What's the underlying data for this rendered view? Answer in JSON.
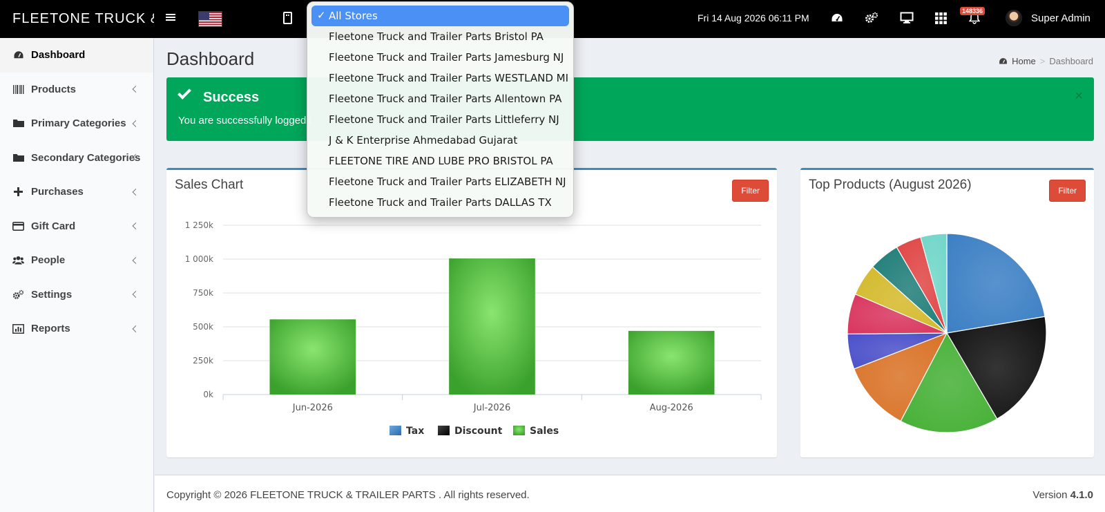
{
  "app": {
    "logo_text": "FLEETONE  TRUCK &",
    "datetime": "Fri 14 Aug 2026 06:11 PM",
    "notification_count": "148336",
    "user_name": "Super Admin"
  },
  "store_dropdown": {
    "options": [
      "All Stores",
      "Fleetone Truck and Trailer Parts Bristol PA",
      "Fleetone Truck and Trailer Parts Jamesburg NJ",
      "Fleetone Truck and Trailer Parts WESTLAND MI",
      "Fleetone Truck and Trailer Parts Allentown PA",
      "Fleetone Truck and Trailer Parts Littleferry NJ",
      "J & K Enterprise Ahmedabad Gujarat",
      "FLEETONE TIRE AND LUBE PRO BRISTOL PA",
      "Fleetone Truck and Trailer Parts ELIZABETH NJ",
      "Fleetone Truck and Trailer Parts DALLAS TX"
    ],
    "selected": "All Stores",
    "check_mark": "✓"
  },
  "sidebar": {
    "items": [
      {
        "label": "Dashboard",
        "icon": "dashboard-icon",
        "active": true
      },
      {
        "label": "Products",
        "icon": "barcode-icon"
      },
      {
        "label": "Primary Categories",
        "icon": "folder-icon"
      },
      {
        "label": "Secondary Categories",
        "icon": "folder-icon"
      },
      {
        "label": "Purchases",
        "icon": "plus-icon"
      },
      {
        "label": "Gift Card",
        "icon": "credit-card-icon"
      },
      {
        "label": "People",
        "icon": "users-icon"
      },
      {
        "label": "Settings",
        "icon": "cogs-icon"
      },
      {
        "label": "Reports",
        "icon": "bar-chart-icon"
      }
    ]
  },
  "page": {
    "title": "Dashboard",
    "breadcrumb": {
      "home": "Home",
      "separator": ">",
      "current": "Dashboard"
    }
  },
  "alert": {
    "title": "Success",
    "message": "You are successfully logged i",
    "close_glyph": "×"
  },
  "sales_box": {
    "title": "Sales Chart",
    "filter_label": "Filter"
  },
  "products_box": {
    "title": "Top Products (August 2026)",
    "filter_label": "Filter"
  },
  "footer": {
    "copyright": "Copyright © 2026 FLEETONE  TRUCK & TRAILER PARTS . All rights reserved.",
    "version_label": "Version",
    "version": "4.1.0"
  },
  "colors": {
    "accent": "#3c8dbc",
    "success": "#00a65a",
    "danger": "#dd4b39"
  },
  "chart_data": [
    {
      "type": "bar",
      "title": "Sales Chart",
      "categories": [
        "Jun-2026",
        "Jul-2026",
        "Aug-2026"
      ],
      "series": [
        {
          "name": "Tax",
          "values": [
            0,
            0,
            0
          ],
          "color": "#3b7fc4"
        },
        {
          "name": "Discount",
          "values": [
            0,
            0,
            0
          ],
          "color": "#111111"
        },
        {
          "name": "Sales",
          "values": [
            555000,
            1005000,
            470000
          ],
          "color": "#4cba3c"
        }
      ],
      "yticks": [
        "0k",
        "250k",
        "500k",
        "750k",
        "1 000k",
        "1 250k"
      ],
      "ylim": [
        0,
        1250000
      ],
      "legend": "bottom",
      "grid": true
    },
    {
      "type": "pie",
      "title": "Top Products (August 2026)",
      "values": [
        21.5,
        18.5,
        15.5,
        11,
        5.5,
        6.3,
        5,
        4.8,
        4,
        4.1
      ],
      "colors": [
        "#3b7fc4",
        "#111111",
        "#45b035",
        "#d97226",
        "#4a4fc9",
        "#d9355e",
        "#d4b92a",
        "#1f7d78",
        "#e04545",
        "#6fd6c8"
      ]
    }
  ]
}
